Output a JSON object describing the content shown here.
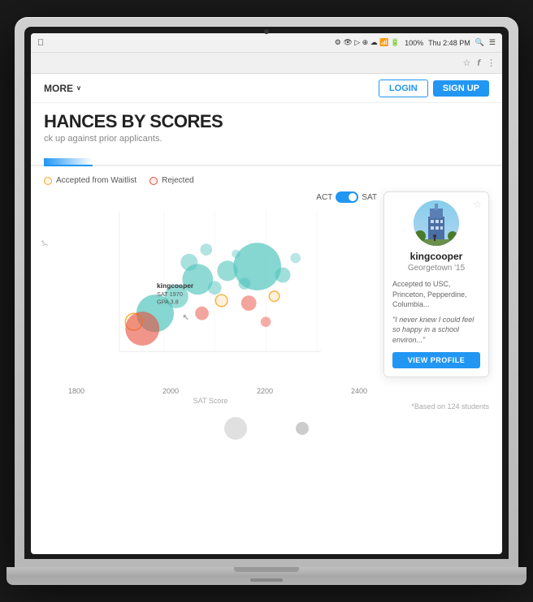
{
  "laptop": {
    "camera_label": "camera"
  },
  "menubar": {
    "time": "Thu 2:48 PM",
    "battery": "100%",
    "wifi_icon": "wifi",
    "search_icon": "search"
  },
  "browser": {
    "star_icon": "star",
    "function_icon": "f",
    "more_icon": "⋮"
  },
  "nav": {
    "more_label": "MORE",
    "login_label": "LOGIN",
    "signup_label": "SIGN UP",
    "chevron": "∨"
  },
  "page": {
    "title": "HANCES BY SCORES",
    "subtitle": "ck up against prior applicants."
  },
  "legend": {
    "accepted_label": "Accepted from Waitlist",
    "rejected_label": "Rejected"
  },
  "chart": {
    "act_label": "ACT",
    "sat_label": "SAT",
    "y_axis_label": "y*",
    "sat_score_label": "SAT Score",
    "x_labels": [
      "1800",
      "2000",
      "2200",
      "2400"
    ],
    "based_on": "*Based on 124 students"
  },
  "tooltip": {
    "username": "kingcooper",
    "sat": "SAT 1970",
    "gpa": "GPA 3.8"
  },
  "profile_card": {
    "star_icon": "☆",
    "name": "kingcooper",
    "school": "Georgetown '15",
    "accepted_desc": "Accepted to USC, Princeton, Pepperdine, Columbia...",
    "quote": "\"I never knew I could feel so happy in a school environ...\"",
    "view_profile_label": "VIEW PROFILE"
  }
}
